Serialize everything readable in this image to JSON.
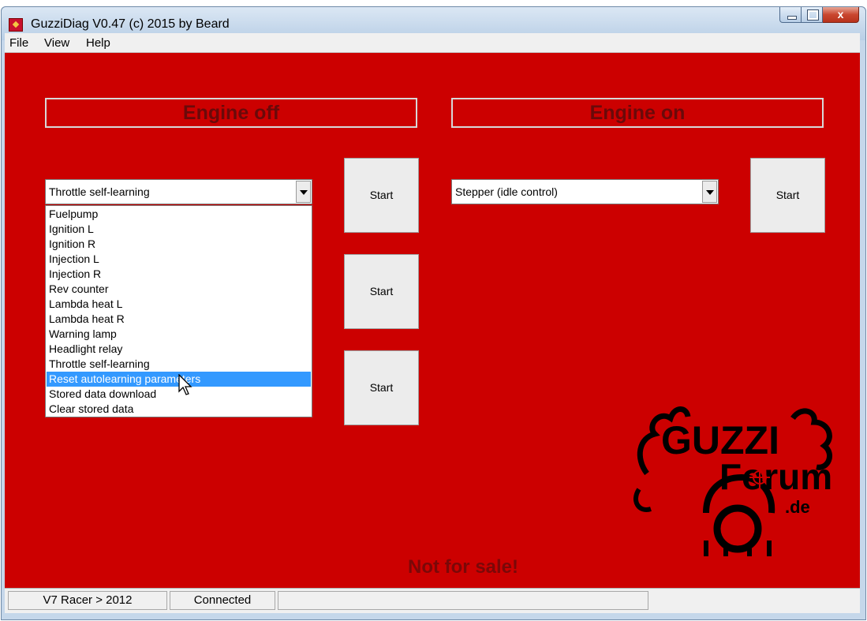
{
  "window": {
    "title": "GuzziDiag V0.47  (c) 2015 by Beard",
    "close_label": "x"
  },
  "menubar": {
    "items": [
      "File",
      "View",
      "Help"
    ]
  },
  "engine_off": {
    "heading": "Engine off",
    "combo_value": "Throttle self-learning",
    "list_items": [
      "Fuelpump",
      "Ignition L",
      "Ignition R",
      "Injection L",
      "Injection R",
      "Rev counter",
      "Lambda heat L",
      "Lambda heat R",
      "Warning lamp",
      "Headlight relay",
      "Throttle self-learning",
      "Reset autolearning parameters",
      "Stored data download",
      "Clear stored data"
    ],
    "selected_index": 11,
    "start_buttons": [
      "Start",
      "Start",
      "Start"
    ]
  },
  "engine_on": {
    "heading": "Engine on",
    "combo_value": "Stepper (idle control)",
    "start_button": "Start"
  },
  "footer_text": "Not for sale!",
  "logo": {
    "line1": "GUZZI",
    "line2": "Forum",
    "line3": ".de",
    "color": "#000000"
  },
  "statusbar": {
    "model": "V7 Racer > 2012",
    "connection": "Connected"
  },
  "colors": {
    "background": "#cc0000",
    "heading_text": "#6a0a0a",
    "selection": "#3399ff"
  }
}
